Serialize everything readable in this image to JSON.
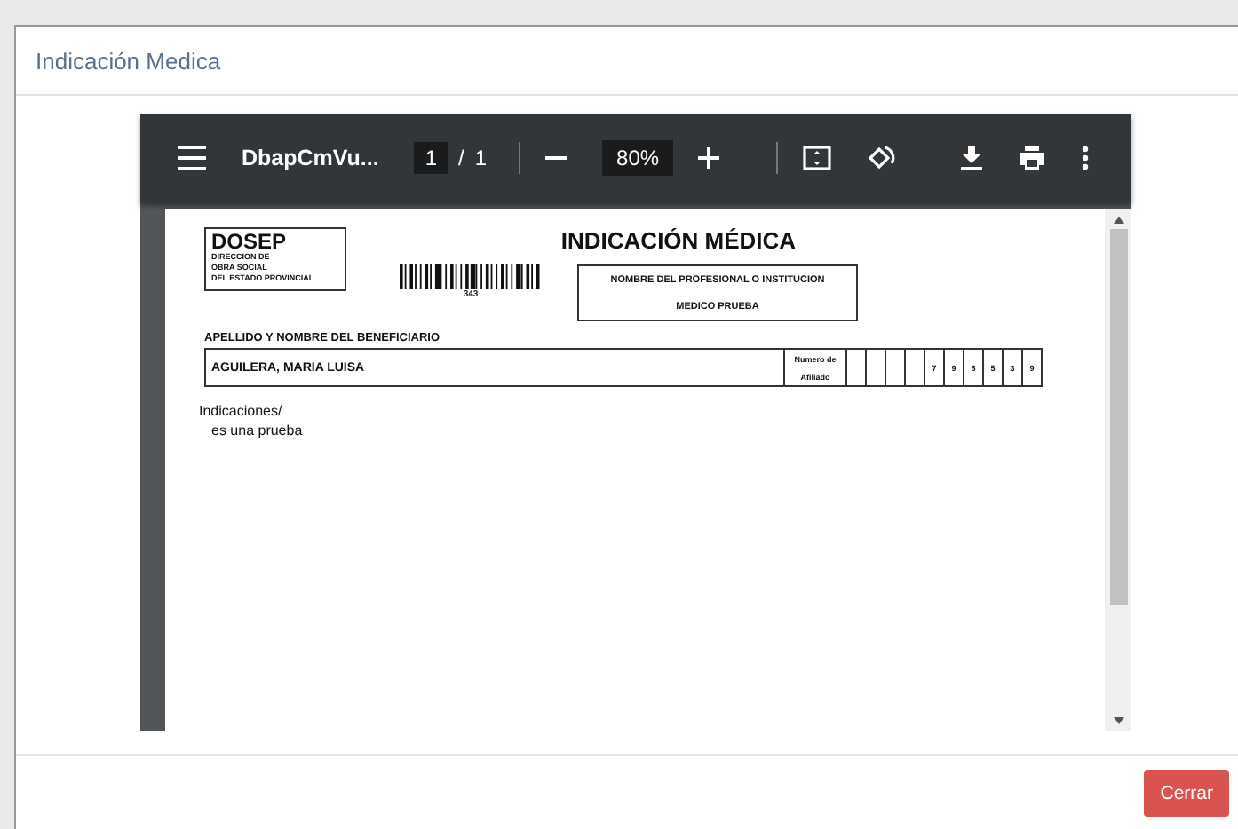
{
  "modal": {
    "title": "Indicación Medica",
    "close_button": "Cerrar"
  },
  "pdf_viewer": {
    "file_name": "DbapCmVu...",
    "page": "1",
    "page_total": "1",
    "separator": "/",
    "zoom": "80%"
  },
  "document": {
    "org_name": "DOSEP",
    "org_lines": [
      "DIRECCION DE",
      "OBRA SOCIAL",
      "DEL ESTADO PROVINCIAL"
    ],
    "title": "INDICACIÓN MÉDICA",
    "barcode_number": "343",
    "professional_label": "NOMBRE DEL PROFESIONAL O INSTITUCION",
    "professional_name": "MEDICO PRUEBA",
    "beneficiary_label": "APELLIDO Y NOMBRE DEL BENEFICIARIO",
    "beneficiary_name": "AGUILERA, MARIA LUISA",
    "affiliate_label": [
      "Numero de",
      "Afiliado"
    ],
    "affiliate_digits": [
      "7",
      "9",
      "6",
      "5",
      "3",
      "9"
    ],
    "indications_label": "Indicaciones/",
    "indications_text": "es una prueba"
  }
}
